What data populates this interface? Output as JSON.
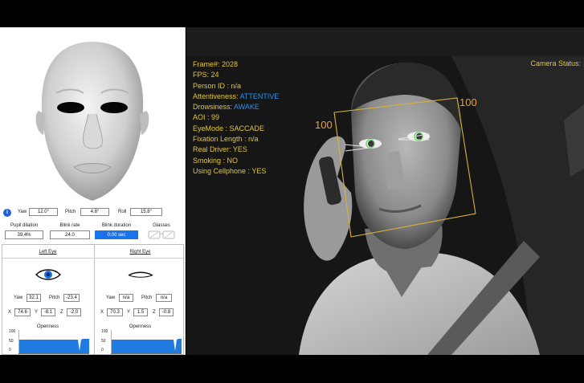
{
  "head_pose": {
    "yaw_label": "Yaw",
    "yaw_value": "12.0°",
    "pitch_label": "Pitch",
    "pitch_value": "4.8°",
    "roll_label": "Roll",
    "roll_value": "15.8°"
  },
  "metrics": {
    "pupil_label": "Pupil dilation",
    "pupil_value": "39.4%",
    "blink_rate_label": "Blink rate",
    "blink_rate_value": "24.0",
    "blink_duration_label": "Blink duration",
    "blink_duration_value": "0.00 sec",
    "glasses_label": "Glasses"
  },
  "left_eye": {
    "title": "Left  Eye",
    "yaw_label": "Yaw",
    "yaw_value": "32.1",
    "pitch_label": "Pitch",
    "pitch_value": "-23.4",
    "x_label": "X",
    "x_value": "74.6",
    "y_label": "Y",
    "y_value": "-8.1",
    "z_label": "Z",
    "z_value": "-2.0",
    "openness_title": "Openness"
  },
  "right_eye": {
    "title": "Right  Eye",
    "yaw_label": "Yaw",
    "yaw_value": "n/a",
    "pitch_label": "Pitch",
    "pitch_value": "n/a",
    "x_label": "X",
    "x_value": "70.3",
    "y_label": "Y",
    "y_value": "1.5",
    "z_label": "Z",
    "z_value": "-0.8",
    "openness_title": "Openness"
  },
  "openness_axis": {
    "top": "100",
    "mid": "50",
    "bottom": "0"
  },
  "camera": {
    "frame_label": "Frame#:",
    "frame_value": "2028",
    "fps_label": "FPS:",
    "fps_value": "24",
    "person_id": "Person ID : n/a",
    "attentiveness_label": "Attentiveness:",
    "attentiveness_value": "ATTENTIVE",
    "drowsiness_label": "Drowsiness:",
    "drowsiness_value": "AWAKE",
    "aoi": "AOI : 99",
    "eye_mode": "EyeMode : SACCADE",
    "fixation": "Fixation Length : n/a",
    "real_driver": "Real Driver: YES",
    "smoking": "Smoking : NO",
    "cellphone": "Using Cellphone : YES",
    "status_label": "Camera Status:",
    "box_left_label": "100",
    "box_right_label": "100"
  },
  "colors": {
    "overlay_yellow": "#e2c53f",
    "overlay_blue": "#2f8fe8",
    "accent_blue": "#1a73e8",
    "box_orange": "#e6a13a"
  }
}
